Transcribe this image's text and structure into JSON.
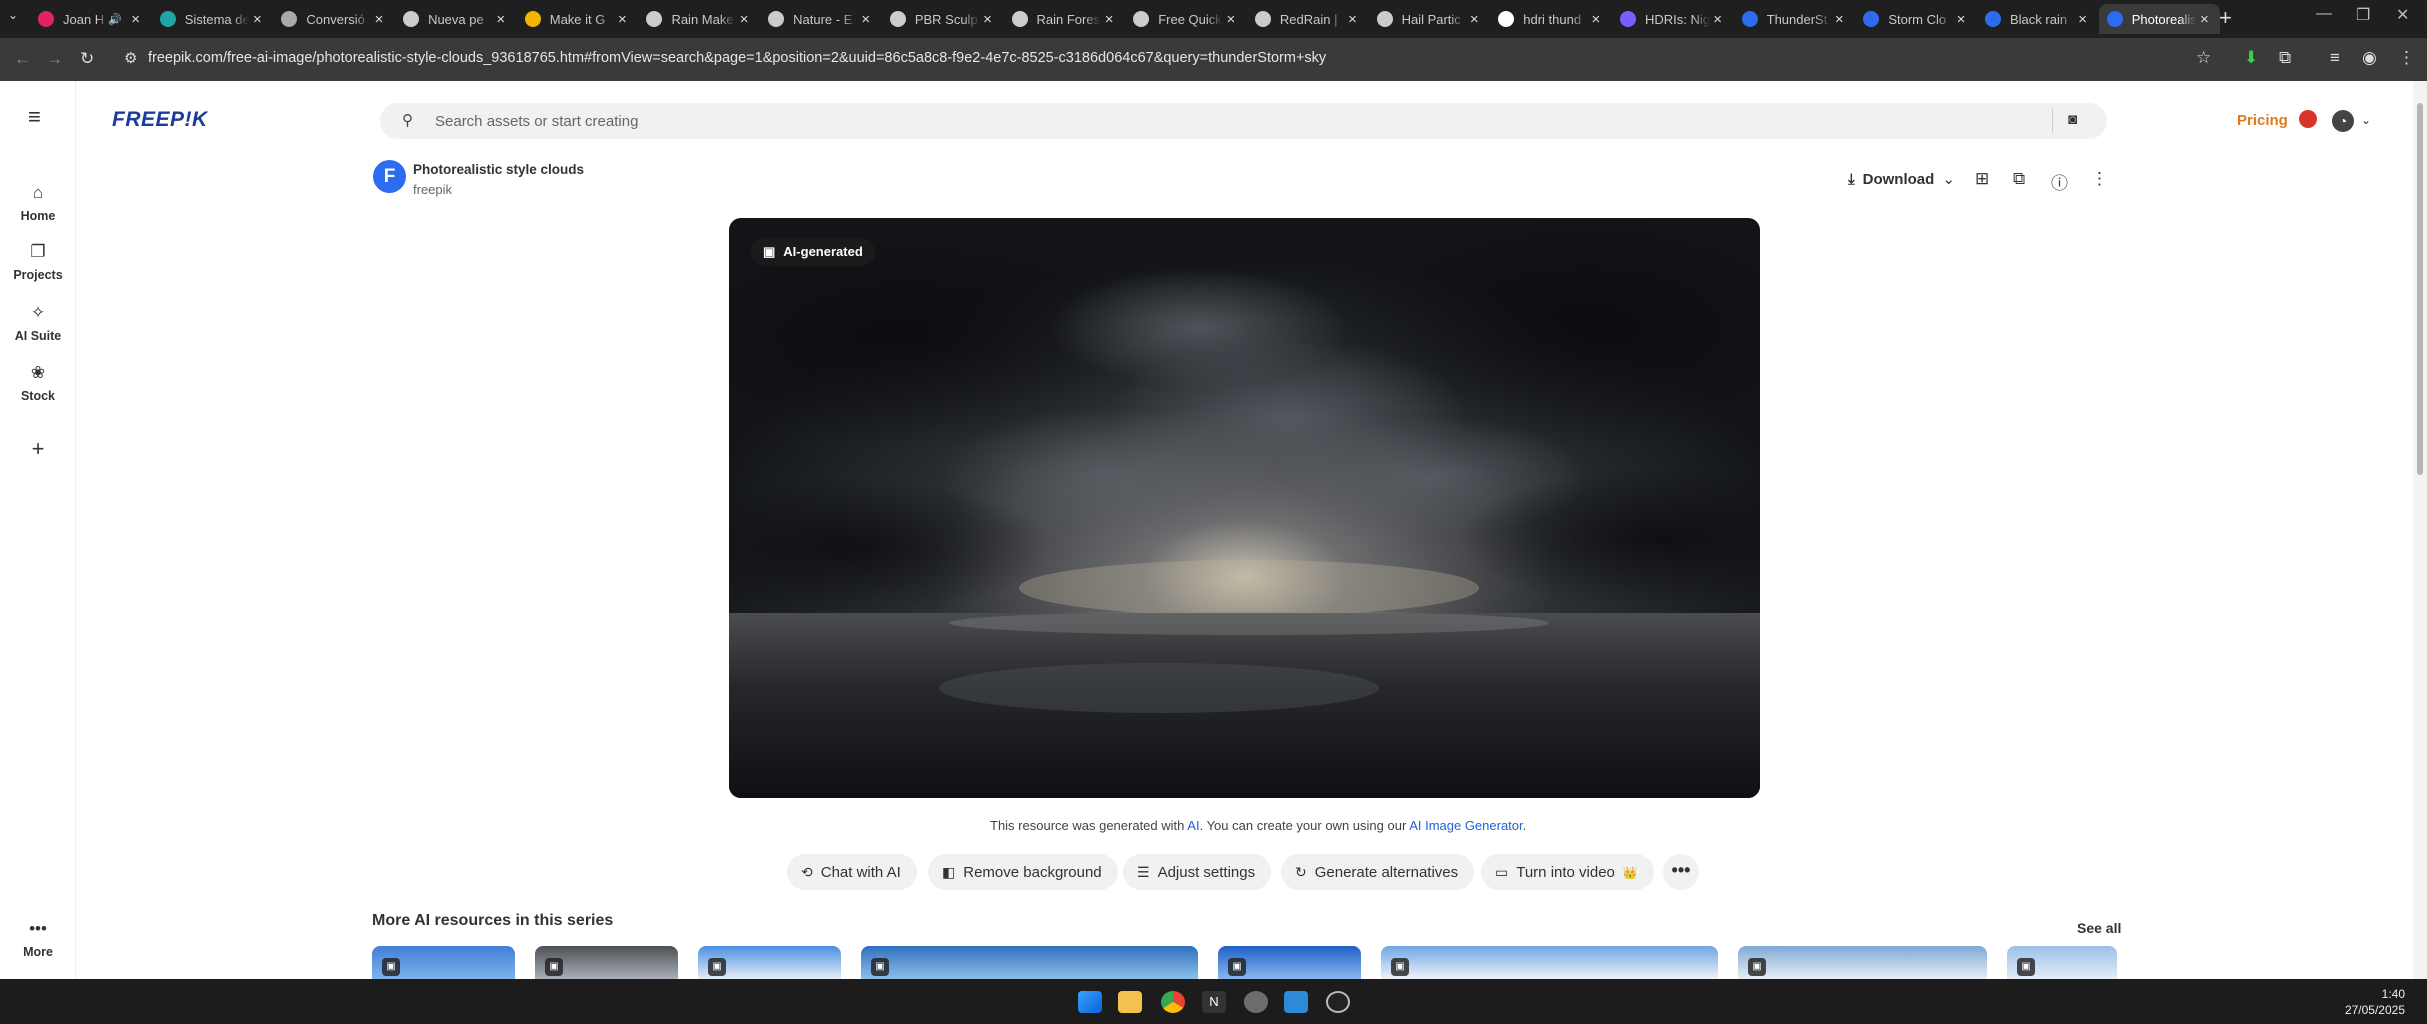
{
  "browser": {
    "tabs": [
      {
        "label": "Joan H",
        "color": "#e0245e",
        "audio": true
      },
      {
        "label": "Sistema de",
        "color": "#1ea6a6"
      },
      {
        "label": "Conversió",
        "color": "#aaaaaa"
      },
      {
        "label": "Nueva pe",
        "color": "#cccccc"
      },
      {
        "label": "Make it G",
        "color": "#f4b400"
      },
      {
        "label": "Rain Make",
        "color": "#cccccc"
      },
      {
        "label": "Nature - E",
        "color": "#cccccc"
      },
      {
        "label": "PBR Sculp",
        "color": "#cccccc"
      },
      {
        "label": "Rain Fores",
        "color": "#cccccc"
      },
      {
        "label": "Free Quick",
        "color": "#cccccc"
      },
      {
        "label": "RedRain | ",
        "color": "#cccccc"
      },
      {
        "label": "Hail Partic",
        "color": "#cccccc"
      },
      {
        "label": "hdri thund",
        "color": "#ffffff"
      },
      {
        "label": "HDRIs: Nig",
        "color": "#7a5cff"
      },
      {
        "label": "ThunderSt",
        "color": "#2d6bf0"
      },
      {
        "label": "Storm Clo",
        "color": "#2d6bf0"
      },
      {
        "label": "Black rain",
        "color": "#2d6bf0"
      },
      {
        "label": "Photorealis",
        "color": "#2d6bf0",
        "active": true
      }
    ],
    "url": "freepik.com/free-ai-image/photorealistic-style-clouds_93618765.htm#fromView=search&page=1&position=2&uuid=86c5a8c8-f9e2-4e7c-8525-c3186d064c67&query=thunderStorm+sky"
  },
  "header": {
    "logo": "FREEP!K",
    "search_placeholder": "Search assets or start creating",
    "pricing": "Pricing"
  },
  "sidebar": {
    "items": [
      {
        "label": "Home",
        "icon": "home-icon",
        "glyph": "⌂"
      },
      {
        "label": "Projects",
        "icon": "projects-icon",
        "glyph": "❐"
      },
      {
        "label": "AI Suite",
        "icon": "ai-suite-icon",
        "glyph": "✧"
      },
      {
        "label": "Stock",
        "icon": "stock-icon",
        "glyph": "❀"
      }
    ],
    "add": "+",
    "more": "More"
  },
  "resource": {
    "title": "Photorealistic style clouds",
    "author": "freepik",
    "author_initial": "F",
    "download": "Download",
    "badge": "AI-generated",
    "note_pre": "This resource was generated with",
    "note_ai": "AI",
    "note_mid": ". You can create your own using our",
    "note_link": "AI Image Generator",
    "note_end": "."
  },
  "actions": [
    {
      "label": "Chat with AI",
      "icon": "chat-icon",
      "glyph": "⟲"
    },
    {
      "label": "Remove background",
      "icon": "remove-bg-icon",
      "glyph": "◧"
    },
    {
      "label": "Adjust settings",
      "icon": "settings-icon",
      "glyph": "☰"
    },
    {
      "label": "Generate alternatives",
      "icon": "refresh-icon",
      "glyph": "↻"
    },
    {
      "label": "Turn into video",
      "icon": "video-icon",
      "glyph": "▭",
      "crown": "👑"
    }
  ],
  "series": {
    "heading": "More AI resources in this series",
    "see_all": "See all"
  },
  "taskbar": {
    "time": "1:40",
    "date": "27/05/2025"
  }
}
